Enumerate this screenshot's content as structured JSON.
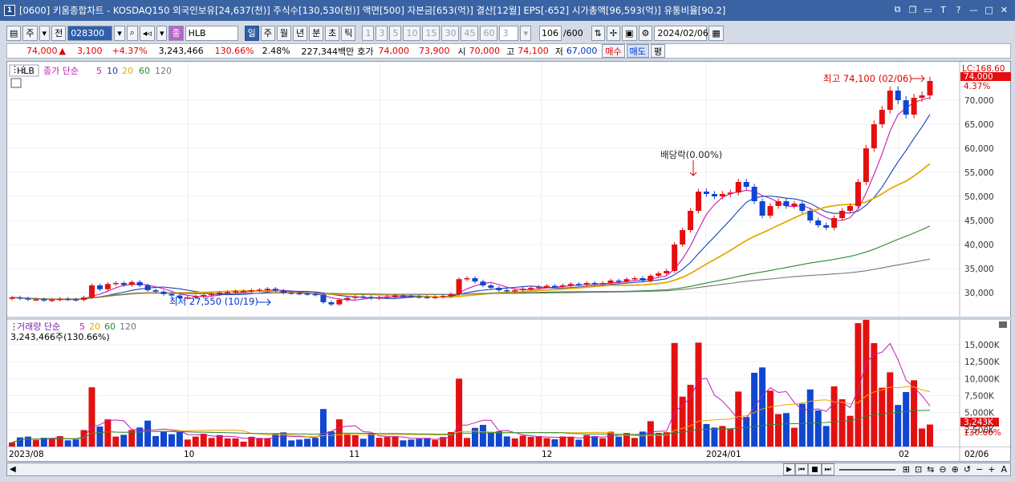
{
  "window": {
    "icon_label": "1",
    "title": "[0600] 키움종합차트 - KOSDAQ150 외국인보유[24,637(천)] 주식수[130,530(천)] 액면[500] 자본금[653(억)] 결산[12월] EPS[-652] 시가총액[96,593(억)] 유통비율[90.2]"
  },
  "toolbar": {
    "period_type": "주",
    "prev": "전",
    "code": "028300",
    "name_tag": "종",
    "name": "HLB",
    "periods": [
      "일",
      "주",
      "월",
      "년",
      "분",
      "초",
      "틱"
    ],
    "selected_period": "일",
    "minutes": [
      "1",
      "3",
      "5",
      "10",
      "15",
      "30",
      "45",
      "60"
    ],
    "count_sel": "3",
    "count": "106",
    "count_total": "/600",
    "date": "2024/02/06"
  },
  "info": {
    "price": "74,000",
    "price_arrow": "▲",
    "change": "3,100",
    "change_pct": "+4.37%",
    "volume": "3,243,466",
    "vol_ratio": "130.66%",
    "turnover": "2.48%",
    "amount": "227,344백만",
    "ask_label": "호가",
    "ask": "74,000",
    "bid": "73,900",
    "open_label": "시",
    "open": "70,000",
    "high_label": "고",
    "high": "74,100",
    "low_label": "저",
    "low": "67,000",
    "buy": "매수",
    "sell": "매도",
    "even": "평"
  },
  "price_pane": {
    "legend_name": "HLB",
    "legend_label": "종가 단순",
    "ma": [
      "5",
      "10",
      "20",
      "60",
      "120"
    ],
    "lc_label": "LC:168.60",
    "current_tag": "74,000",
    "current_pct": "4.37%",
    "high_annot": "최고 74,100 (02/06)",
    "low_annot": "최저 27,550 (10/19)",
    "div_annot": "배당락(0.00%)",
    "y_ticks": [
      "70,000",
      "65,000",
      "60,000",
      "55,000",
      "50,000",
      "45,000",
      "40,000",
      "35,000",
      "30,000"
    ]
  },
  "vol_pane": {
    "legend_label": "거래량 단순",
    "ma": [
      "5",
      "20",
      "60",
      "120"
    ],
    "summary": "3,243,466주(130.66%)",
    "y_ticks": [
      "15,000K",
      "12,500K",
      "10,000K",
      "7,500K",
      "5,000K",
      "2,500K"
    ],
    "current_tag": "3,243K",
    "current_pct": "130.66%"
  },
  "x_axis": {
    "labels": [
      "2023/08",
      "10",
      "11",
      "12",
      "2024/01",
      "02",
      "02/06"
    ]
  },
  "colors": {
    "up": "#e41010",
    "down": "#1046d0",
    "ma5": "#c21bb5",
    "ma10": "#1a3fbf",
    "ma20": "#e8a800",
    "ma60": "#2a8a32",
    "ma120": "#777777",
    "title_bg": "#3a63a3"
  },
  "chart_data": {
    "type": "candlestick",
    "x": [
      "2023/08",
      "10",
      "11",
      "12",
      "2024/01",
      "02"
    ],
    "ylim": [
      25000,
      76000
    ],
    "candles_approx_close": [
      29000,
      28800,
      28600,
      28600,
      28400,
      28500,
      28700,
      28600,
      28500,
      29000,
      31500,
      30700,
      31800,
      32000,
      31600,
      32200,
      31500,
      30500,
      30200,
      29700,
      29400,
      28900,
      29000,
      29200,
      29500,
      29700,
      30000,
      30100,
      30300,
      30300,
      30500,
      30600,
      30800,
      30400,
      30000,
      29900,
      29800,
      29700,
      29600,
      28000,
      27550,
      28500,
      28900,
      29200,
      29100,
      28800,
      29000,
      29200,
      29400,
      29300,
      29200,
      29100,
      29000,
      29100,
      29300,
      29700,
      32800,
      33000,
      32300,
      31500,
      31000,
      30500,
      30300,
      30500,
      30800,
      31000,
      31200,
      31400,
      31300,
      31500,
      31800,
      31700,
      32000,
      31800,
      32000,
      32500,
      32300,
      32800,
      33000,
      32500,
      33500,
      34000,
      34500,
      40000,
      43000,
      47000,
      51000,
      50500,
      50000,
      50500,
      50800,
      53000,
      52000,
      49000,
      46000,
      48000,
      49000,
      48000,
      48500,
      47000,
      45000,
      44000,
      43500,
      45500,
      47000,
      48000,
      53000,
      60000,
      65000,
      68000,
      72000,
      70000,
      67000,
      70500,
      71000,
      74000
    ],
    "volume_last_K": 3243,
    "volume_ylim_K": [
      0,
      17000
    ]
  },
  "bottom": {
    "icons": [
      "▶",
      "⏮",
      "■",
      "⏭"
    ]
  }
}
